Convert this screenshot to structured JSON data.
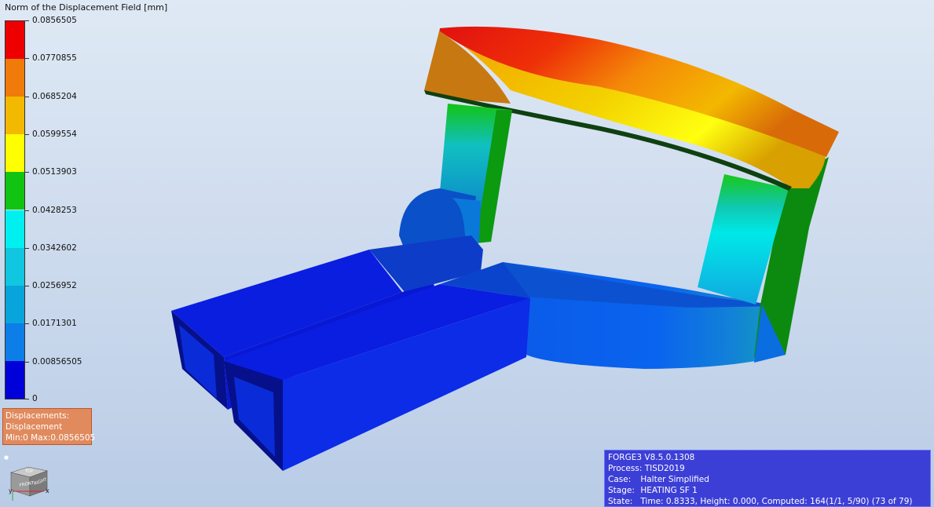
{
  "legend": {
    "title": "Norm of the Displacement Field  [mm]",
    "ticks": [
      "0.0856505",
      "0.0770855",
      "0.0685204",
      "0.0599554",
      "0.0513903",
      "0.0428253",
      "0.0342602",
      "0.0256952",
      "0.0171301",
      "0.00856505",
      "0"
    ],
    "colors": [
      "#ee0000",
      "#f07a0a",
      "#f3b800",
      "#ffff00",
      "#12c412",
      "#00f0f0",
      "#10c6e0",
      "#08a4dc",
      "#0c7ee8",
      "#0a50e8",
      "#0000d8"
    ]
  },
  "result_info": {
    "line1": "Displacements:",
    "line2": "Displacement",
    "line3": "Min:0 Max:0.0856505"
  },
  "orientation_cube": {
    "faces": [
      "FRONT",
      "RIGHT",
      "TOP"
    ],
    "axes": [
      "x",
      "y"
    ]
  },
  "status": {
    "version": "FORGE3 V8.5.0.1308",
    "process_label": "Process:",
    "process_value": "TISD2019",
    "case_label": "Case:",
    "case_value": "Halter Simplified",
    "stage_label": "Stage:",
    "stage_value": "HEATING SF 1",
    "state_label": "State:",
    "state_value": "Time: 0.8333, Height: 0.000, Computed: 164(1/1, 5/90) (73 of 79)"
  }
}
